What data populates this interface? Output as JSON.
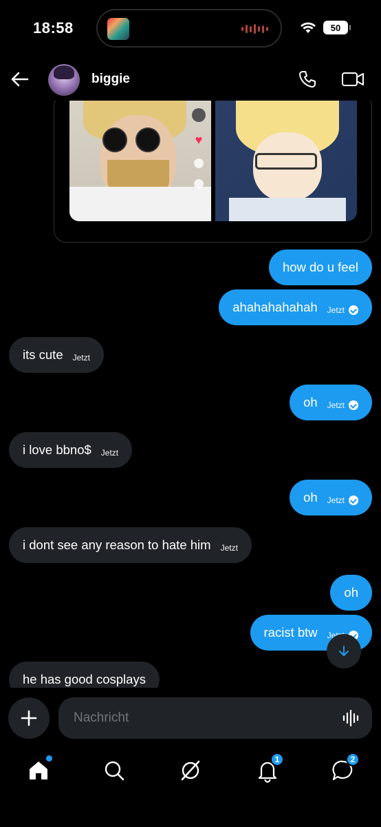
{
  "status_bar": {
    "time": "18:58",
    "battery": "50"
  },
  "header": {
    "contact_name": "biggie"
  },
  "messages": [
    {
      "dir": "out",
      "text": "how do u feel",
      "time": ""
    },
    {
      "dir": "out",
      "text": "ahahahahahah",
      "time": "Jetzt"
    },
    {
      "dir": "in",
      "text": "its cute",
      "time": "Jetzt"
    },
    {
      "dir": "out",
      "text": "oh",
      "time": "Jetzt"
    },
    {
      "dir": "in",
      "text": "i love bbno$",
      "time": "Jetzt"
    },
    {
      "dir": "out",
      "text": "oh",
      "time": "Jetzt"
    },
    {
      "dir": "in",
      "text": "i dont see any reason to hate him",
      "time": "Jetzt"
    },
    {
      "dir": "out",
      "text": "oh",
      "time": ""
    },
    {
      "dir": "out",
      "text": "racist btw",
      "time": "Jetzt"
    },
    {
      "dir": "in",
      "text": "he has good cosplays",
      "time": ""
    }
  ],
  "composer": {
    "placeholder": "Nachricht"
  },
  "nav": {
    "notifications_badge": "1",
    "messages_badge": "2"
  },
  "colors": {
    "accent": "#1d9bf0",
    "incoming_bubble": "#202327",
    "background": "#000000"
  },
  "icons": [
    "back-arrow-icon",
    "phone-icon",
    "video-camera-icon",
    "plus-icon",
    "voice-wave-icon",
    "home-icon",
    "search-icon",
    "grok-icon",
    "bell-icon",
    "message-icon",
    "arrow-down-icon"
  ]
}
